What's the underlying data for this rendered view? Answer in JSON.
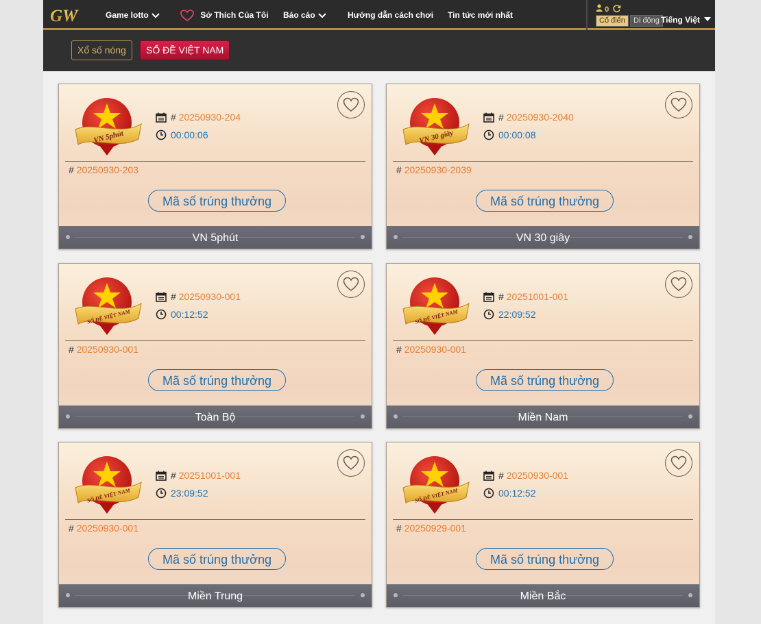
{
  "nav": {
    "logo_text": "GW",
    "items": [
      {
        "label": "Game lotto",
        "has_dropdown": true,
        "icon": "chevron-down-icon"
      },
      {
        "label": "Sở Thích Của Tôi",
        "icon": "heart-icon"
      },
      {
        "label": "Báo cáo",
        "has_dropdown": true,
        "icon": "chevron-down-icon"
      },
      {
        "label": "Hướng dẫn cách chơi"
      },
      {
        "label": "Tin tức mới nhất"
      }
    ]
  },
  "account": {
    "balance": "0",
    "user_icon": "user-icon",
    "refresh_icon": "refresh-icon",
    "mode_classic": "Cổ điển",
    "mode_mobile": "Di động",
    "language": "Tiếng Việt"
  },
  "subnav": {
    "hot": "Xổ số nóng",
    "vietnam": "SỐ ĐỀ VIỆT NAM"
  },
  "colors": {
    "accent_red": "#c8173b",
    "gold": "#b88f3c",
    "period_orange": "#e67e32",
    "timer_blue": "#1a6fb3"
  },
  "cards": [
    {
      "emblem_text": "VN 5phút",
      "period": "20250930-204",
      "timer": "00:00:06",
      "previous": "20250930-203",
      "button": "Mã số trúng thưởng",
      "name": "VN 5phút"
    },
    {
      "emblem_text": "VN 30 giây",
      "period": "20250930-2040",
      "timer": "00:00:08",
      "previous": "20250930-2039",
      "button": "Mã số trúng thưởng",
      "name": "VN 30 giây"
    },
    {
      "emblem_text": "SỐ ĐỀ VIỆT NAM",
      "period": "20250930-001",
      "timer": "00:12:52",
      "previous": "20250930-001",
      "button": "Mã số trúng thưởng",
      "name": "Toàn Bộ"
    },
    {
      "emblem_text": "SỐ ĐỀ VIỆT NAM",
      "period": "20251001-001",
      "timer": "22:09:52",
      "previous": "20250930-001",
      "button": "Mã số trúng thưởng",
      "name": "Miền Nam"
    },
    {
      "emblem_text": "SỐ ĐỀ VIỆT NAM",
      "period": "20251001-001",
      "timer": "23:09:52",
      "previous": "20250930-001",
      "button": "Mã số trúng thưởng",
      "name": "Miền Trung"
    },
    {
      "emblem_text": "SỐ ĐỀ VIỆT NAM",
      "period": "20250930-001",
      "timer": "00:12:52",
      "previous": "20250929-001",
      "button": "Mã số trúng thưởng",
      "name": "Miền Bắc"
    }
  ]
}
